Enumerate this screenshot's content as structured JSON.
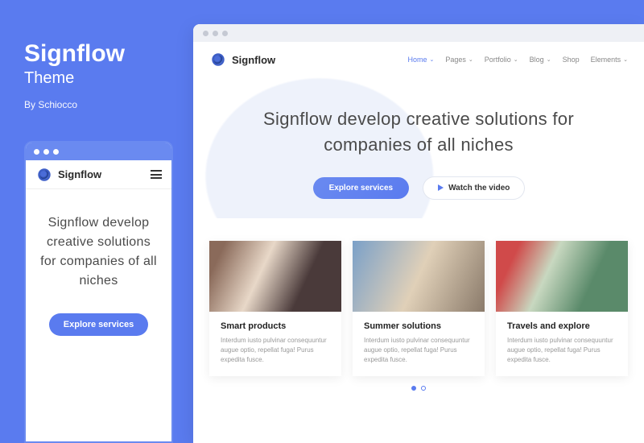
{
  "promo": {
    "title": "Signflow",
    "subtitle": "Theme",
    "author": "By Schiocco"
  },
  "brand": "Signflow",
  "nav": {
    "items": [
      {
        "label": "Home",
        "active": true,
        "chev": true
      },
      {
        "label": "Pages",
        "chev": true
      },
      {
        "label": "Portfolio",
        "chev": true
      },
      {
        "label": "Blog",
        "chev": true
      },
      {
        "label": "Shop",
        "chev": false
      },
      {
        "label": "Elements",
        "chev": true
      }
    ]
  },
  "hero": {
    "headline": "Signflow develop creative solutions for companies of all niches",
    "cta_primary": "Explore services",
    "cta_video": "Watch the video"
  },
  "cards": [
    {
      "title": "Smart products",
      "desc": "Interdum iusto pulvinar consequuntur augue optio, repellat fuga! Purus expedita fusce."
    },
    {
      "title": "Summer solutions",
      "desc": "Interdum iusto pulvinar consequuntur augue optio, repellat fuga! Purus expedita fusce."
    },
    {
      "title": "Travels and explore",
      "desc": "Interdum iusto pulvinar consequuntur augue optio, repellat fuga! Purus expedita fusce."
    }
  ]
}
